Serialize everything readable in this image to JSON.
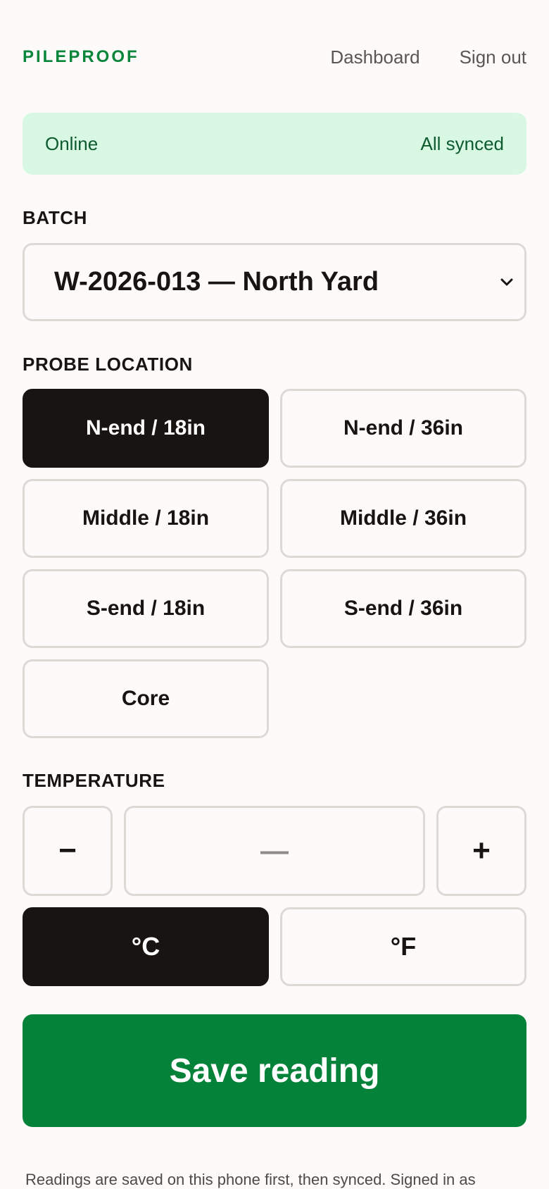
{
  "header": {
    "brand": "PILEPROOF",
    "nav": {
      "dashboard": "Dashboard",
      "sign_out": "Sign out"
    }
  },
  "status": {
    "connection": "Online",
    "sync": "All synced",
    "colors": {
      "background": "#d9f8e4",
      "text": "#0c5a2e"
    }
  },
  "batch": {
    "label": "BATCH",
    "selected": "W-2026-013 — North Yard",
    "icon": "chevron-down-icon"
  },
  "probe": {
    "label": "PROBE LOCATION",
    "selected": "N-end / 18in",
    "options": [
      "N-end / 18in",
      "N-end / 36in",
      "Middle / 18in",
      "Middle / 36in",
      "S-end / 18in",
      "S-end / 36in",
      "Core"
    ]
  },
  "temperature": {
    "label": "TEMPERATURE",
    "decrement": "−",
    "increment": "+",
    "value": "—",
    "units": {
      "celsius": "°C",
      "fahrenheit": "°F",
      "selected": "°C"
    }
  },
  "actions": {
    "save": "Save reading"
  },
  "footer": {
    "note": "Readings are saved on this phone first, then synced. Signed in as"
  },
  "theme": {
    "brand_green": "#07853a",
    "save_green": "#05823a",
    "selected_dark": "#171411"
  }
}
